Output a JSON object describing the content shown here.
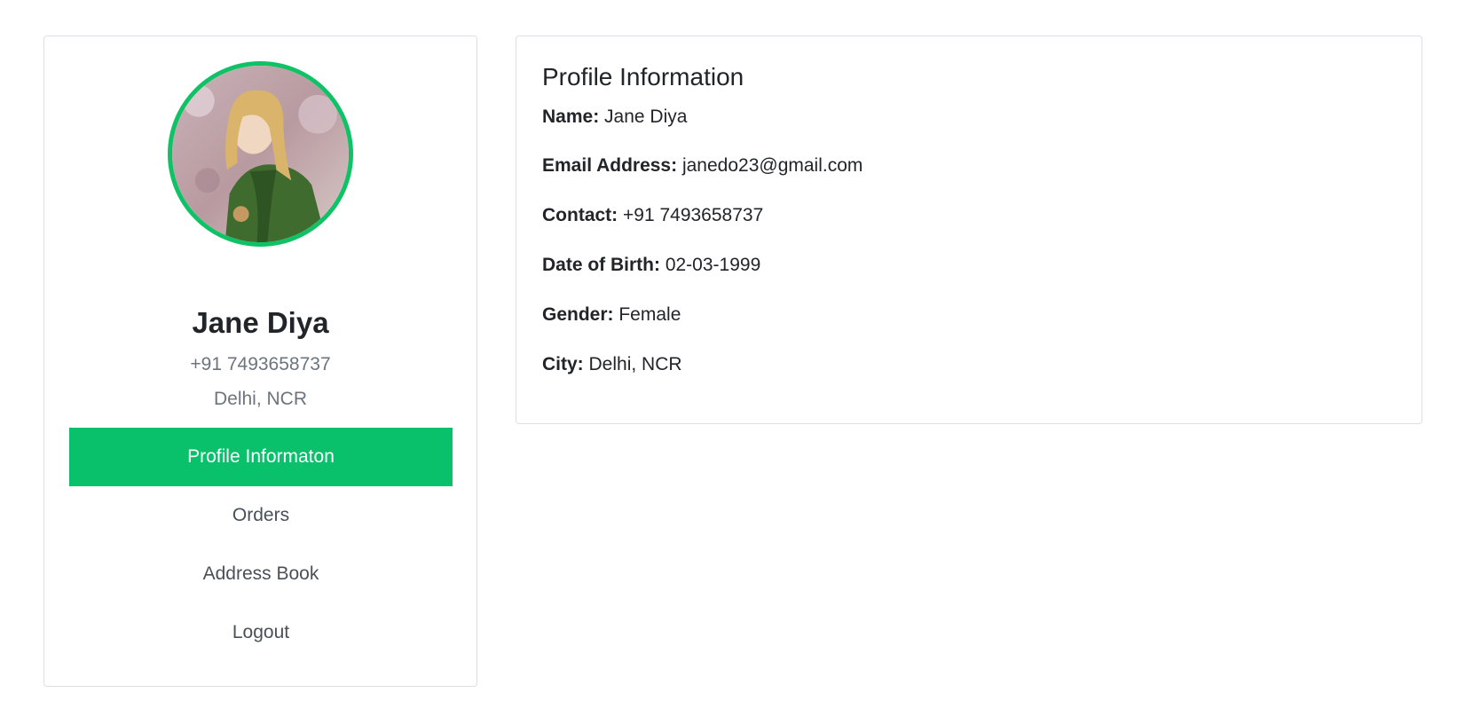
{
  "user": {
    "name": "Jane Diya",
    "phone": "+91 7493658737",
    "city": "Delhi, NCR"
  },
  "sidebar": {
    "items": [
      {
        "label": "Profile Informaton",
        "active": true
      },
      {
        "label": "Orders",
        "active": false
      },
      {
        "label": "Address Book",
        "active": false
      },
      {
        "label": "Logout",
        "active": false
      }
    ]
  },
  "profile_info": {
    "title": "Profile Information",
    "fields": [
      {
        "label": "Name:",
        "value": "Jane Diya"
      },
      {
        "label": "Email Address:",
        "value": "janedo23@gmail.com"
      },
      {
        "label": "Contact:",
        "value": "+91 7493658737"
      },
      {
        "label": "Date of Birth:",
        "value": "02-03-1999"
      },
      {
        "label": "Gender:",
        "value": "Female"
      },
      {
        "label": "City:",
        "value": "Delhi, NCR"
      }
    ]
  },
  "colors": {
    "accent": "#08c16a",
    "avatar_border": "#10c266",
    "muted_text": "#6c757d",
    "border": "#dcdfe3"
  },
  "icons": {
    "avatar": "user-avatar-photo"
  }
}
